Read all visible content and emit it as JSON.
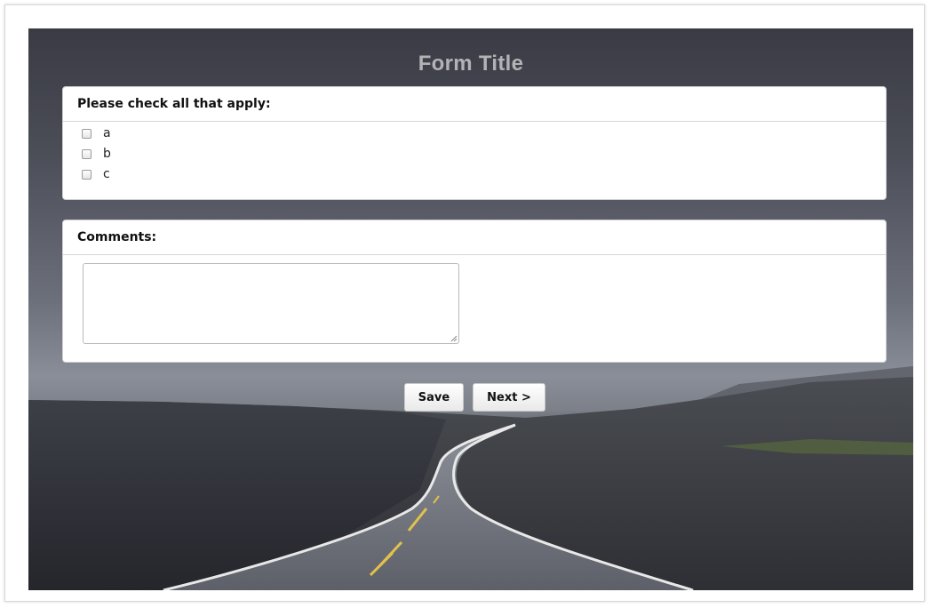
{
  "form": {
    "title": "Form Title",
    "checkbox_panel": {
      "heading": "Please check all that apply:",
      "options": [
        {
          "label": "a",
          "checked": false
        },
        {
          "label": "b",
          "checked": false
        },
        {
          "label": "c",
          "checked": false
        }
      ]
    },
    "comments_panel": {
      "heading": "Comments:",
      "value": ""
    },
    "buttons": {
      "save_label": "Save",
      "next_label": "Next >"
    }
  },
  "colors": {
    "title_text": "#b3b3b6",
    "panel_bg": "#ffffff",
    "button_bg": "#f3f3f3"
  }
}
